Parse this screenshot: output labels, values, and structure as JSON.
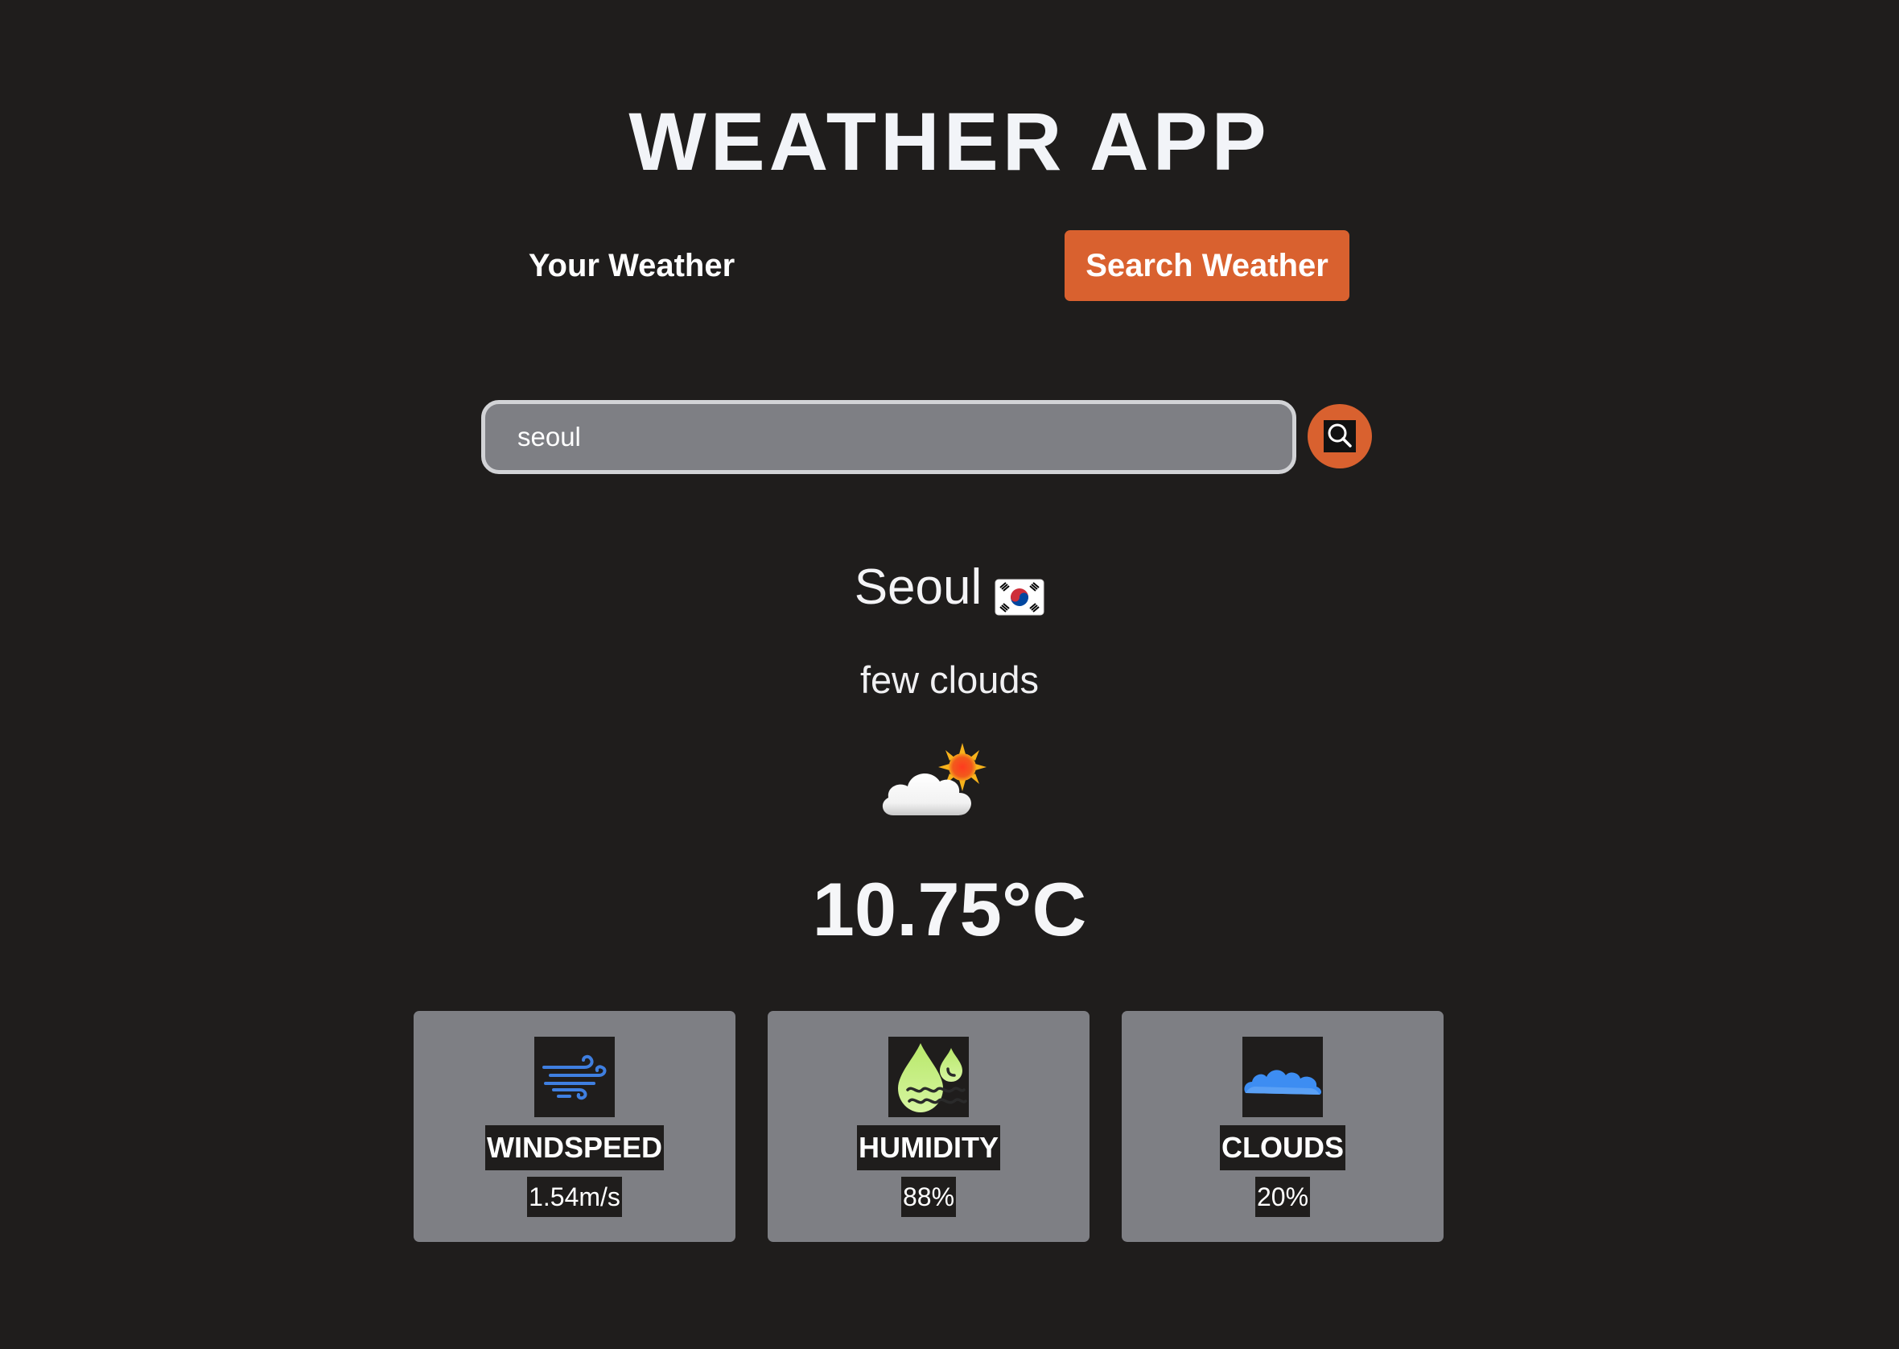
{
  "app": {
    "title": "WEATHER APP"
  },
  "tabs": [
    {
      "label": "Your Weather",
      "active": false
    },
    {
      "label": "Search Weather",
      "active": true
    }
  ],
  "search": {
    "value": "seoul",
    "placeholder": "",
    "button_icon": "search-icon"
  },
  "weather": {
    "city": "Seoul",
    "flag_icon": "south-korea-flag-icon",
    "description": "few clouds",
    "condition_icon": "cloud-sun-icon",
    "temperature": "10.75°C"
  },
  "stats": [
    {
      "label": "WINDSPEED",
      "value": "1.54m/s",
      "icon": "wind-icon"
    },
    {
      "label": "HUMIDITY",
      "value": "88%",
      "icon": "humidity-icon"
    },
    {
      "label": "CLOUDS",
      "value": "20%",
      "icon": "clouds-icon"
    }
  ],
  "colors": {
    "background": "#1f1d1c",
    "accent": "#d9612f",
    "card": "#7e7f84"
  }
}
